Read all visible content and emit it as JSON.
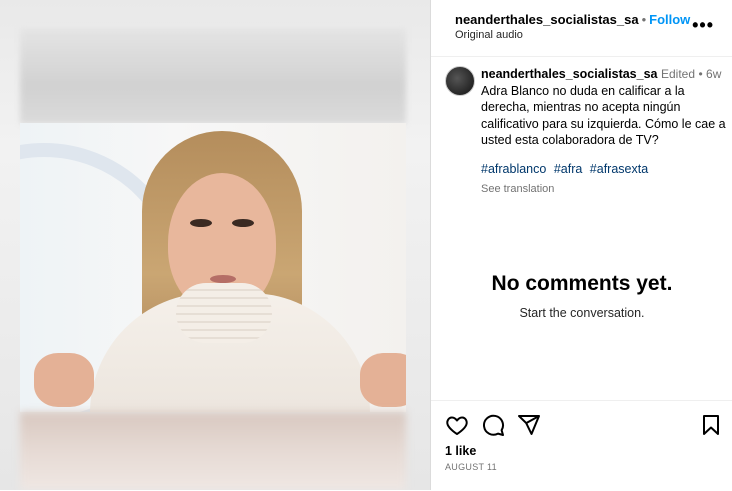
{
  "post": {
    "username": "neanderthales_socialistas_sa",
    "follow_label": "Follow",
    "audio": "Original audio",
    "more_icon": "more-options-icon"
  },
  "caption": {
    "username": "neanderthales_socialistas_sa",
    "edited": "Edited",
    "age": "6w",
    "text": "Adra Blanco no duda en calificar a la derecha, mientras no acepta ningún calificativo para su izquierda. Cómo le cae a usted esta colaboradora de TV?",
    "hashtags": [
      "#afrablanco",
      "#afra",
      "#afrasexta"
    ],
    "see_translation": "See translation"
  },
  "comments": {
    "empty_title": "No comments yet.",
    "empty_subtitle": "Start the conversation."
  },
  "actions": {
    "likes": "1 like",
    "date": "AUGUST 11",
    "icons": [
      "heart-icon",
      "comment-icon",
      "share-icon",
      "bookmark-icon"
    ]
  }
}
